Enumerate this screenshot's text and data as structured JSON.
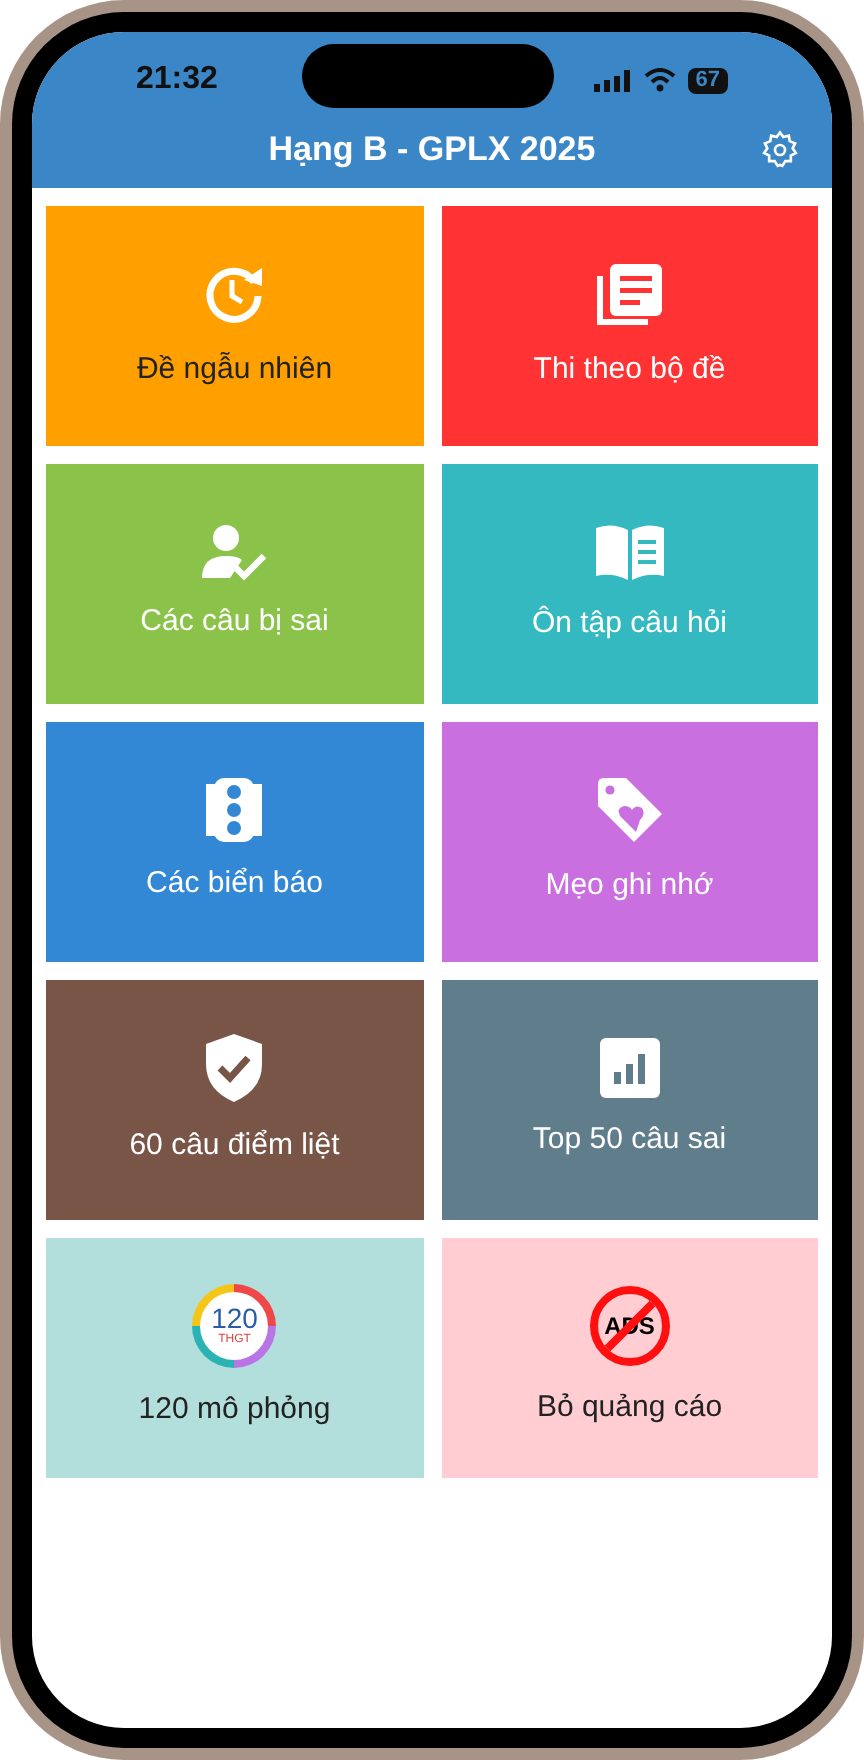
{
  "status_bar": {
    "time": "21:32",
    "battery": "67"
  },
  "header": {
    "title": "Hạng B - GPLX 2025"
  },
  "tiles": [
    {
      "label": "Đề ngẫu nhiên",
      "kind": "clock",
      "color": "#ffa000"
    },
    {
      "label": "Thi theo bộ đề",
      "kind": "papers",
      "color": "#ff3333"
    },
    {
      "label": "Các câu bị sai",
      "kind": "user-check",
      "color": "#8bc34a"
    },
    {
      "label": "Ôn tập câu hỏi",
      "kind": "book",
      "color": "#33b9bf"
    },
    {
      "label": "Các biển báo",
      "kind": "traffic-light",
      "color": "#3388d6"
    },
    {
      "label": "Mẹo ghi nhớ",
      "kind": "tag",
      "color": "#c96fe0"
    },
    {
      "label": "60 câu điểm liệt",
      "kind": "shield",
      "color": "#795548"
    },
    {
      "label": "Top 50 câu sai",
      "kind": "chart",
      "color": "#607d8b"
    },
    {
      "label": "120 mô phỏng",
      "kind": "ring",
      "color": "#b2dfdb",
      "number": "120",
      "caption": "THGT"
    },
    {
      "label": "Bỏ quảng cáo",
      "kind": "no-ads",
      "color": "#ffcdd2",
      "badge_text": "ADS"
    }
  ]
}
